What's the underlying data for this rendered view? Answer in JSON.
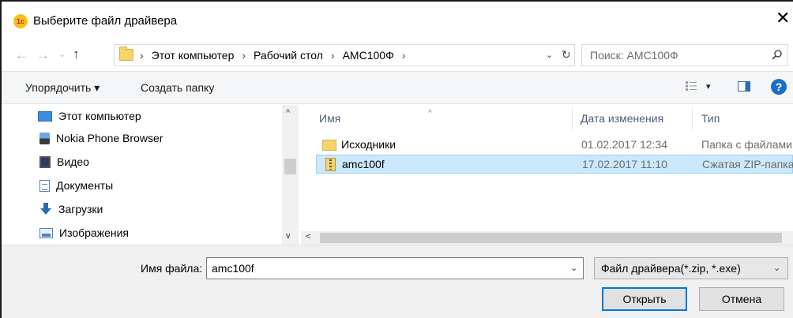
{
  "window": {
    "title": "Выберите файл драйвера",
    "app_icon_text": "1с",
    "close_glyph": "✕"
  },
  "nav": {
    "back_glyph": "←",
    "forward_glyph": "→",
    "recent_glyph": "⌄",
    "up_glyph": "↑",
    "breadcrumb": [
      "Этот компьютер",
      "Рабочий стол",
      "АМС100Ф"
    ],
    "separator": "›",
    "address_dropdown_glyph": "⌄",
    "refresh_glyph": "↻",
    "search_placeholder": "Поиск: АМС100Ф"
  },
  "toolbar": {
    "organize_label": "Упорядочить ▾",
    "new_folder_label": "Создать папку",
    "view_dropdown_glyph": "▾",
    "help_glyph": "?"
  },
  "sidebar": {
    "items": [
      {
        "label": "Этот компьютер",
        "icon": "computer-icon"
      },
      {
        "label": "Nokia Phone Browser",
        "icon": "phone-icon"
      },
      {
        "label": "Видео",
        "icon": "video-icon"
      },
      {
        "label": "Документы",
        "icon": "documents-icon"
      },
      {
        "label": "Загрузки",
        "icon": "downloads-icon"
      },
      {
        "label": "Изображения",
        "icon": "pictures-icon"
      }
    ],
    "scroll_up_glyph": "^",
    "scroll_down_glyph": "v"
  },
  "filelist": {
    "columns": [
      "Имя",
      "Дата изменения",
      "Тип"
    ],
    "sort_glyph": "^",
    "rows": [
      {
        "name": "Исходники",
        "date": "01.02.2017 12:34",
        "type": "Папка с файлами",
        "icon": "folder-icon",
        "selected": false
      },
      {
        "name": "amc100f",
        "date": "17.02.2017 11:10",
        "type": "Сжатая ZIP-папка",
        "icon": "zip-folder-icon",
        "selected": true
      }
    ],
    "hscroll_left_glyph": "<"
  },
  "footer": {
    "filename_label": "Имя файла:",
    "filename_value": "amc100f",
    "filename_dropdown_glyph": "⌄",
    "filetype_value": "Файл драйвера(*.zip, *.exe)",
    "filetype_dropdown_glyph": "⌄",
    "open_label": "Открыть",
    "cancel_label": "Отмена"
  },
  "colors": {
    "accent": "#0078d7",
    "selection_bg": "#cce8ff",
    "selection_border": "#99d1ff",
    "folder": "#f6d36b",
    "help": "#1a6ec7"
  }
}
